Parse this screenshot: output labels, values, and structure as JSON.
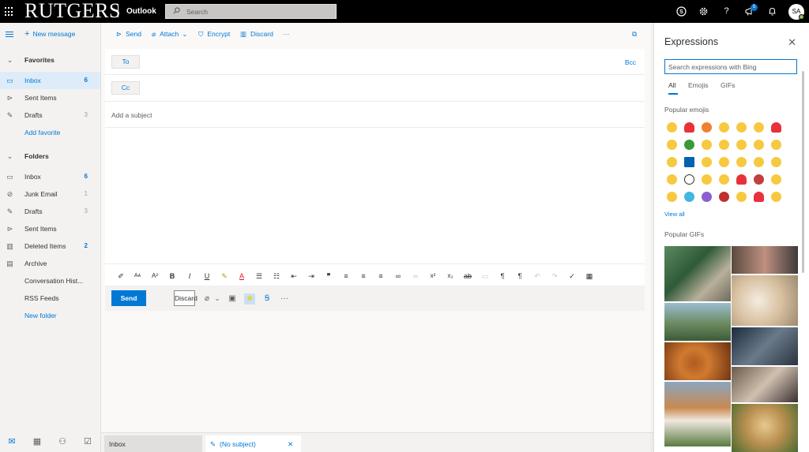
{
  "topbar": {
    "brand": "RUTGERS",
    "app_name": "Outlook",
    "search_placeholder": "Search",
    "notification_count": "5",
    "avatar_initials": "SA"
  },
  "command_bar": {
    "new_message": "New message",
    "send": "Send",
    "attach": "Attach",
    "encrypt": "Encrypt",
    "discard": "Discard",
    "more": "···"
  },
  "nav": {
    "favorites_header": "Favorites",
    "favorites": [
      {
        "label": "Inbox",
        "count": "6"
      },
      {
        "label": "Sent Items",
        "count": ""
      },
      {
        "label": "Drafts",
        "count": "3"
      }
    ],
    "add_favorite": "Add favorite",
    "folders_header": "Folders",
    "folders": [
      {
        "label": "Inbox",
        "count": "6"
      },
      {
        "label": "Junk Email",
        "count": "1"
      },
      {
        "label": "Drafts",
        "count": "3"
      },
      {
        "label": "Sent Items",
        "count": ""
      },
      {
        "label": "Deleted Items",
        "count": "2"
      },
      {
        "label": "Archive",
        "count": ""
      },
      {
        "label": "Conversation Hist...",
        "count": ""
      },
      {
        "label": "RSS Feeds",
        "count": ""
      }
    ],
    "new_folder": "New folder"
  },
  "compose": {
    "to_label": "To",
    "cc_label": "Cc",
    "bcc_label": "Bcc",
    "subject_placeholder": "Add a subject",
    "send_button": "Send",
    "discard_button": "Discard",
    "more": "···"
  },
  "tabs": {
    "inbox": "Inbox",
    "draft": "(No subject)"
  },
  "expressions": {
    "title": "Expressions",
    "search_placeholder": "Search expressions with Bing",
    "tabs": [
      "All",
      "Emojis",
      "GIFs"
    ],
    "popular_emojis_label": "Popular emojis",
    "view_all": "View all",
    "popular_gifs_label": "Popular GIFs"
  },
  "colors": {
    "accent": "#0078d4",
    "topbar": "#000000",
    "emoji_yellow": "#f7c940",
    "heart_red": "#e8313a"
  }
}
